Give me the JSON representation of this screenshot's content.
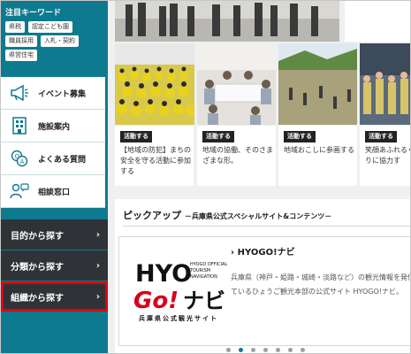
{
  "sidebar": {
    "keyword_title": "注目キーワード",
    "tags": [
      "県税",
      "認定こども園",
      "職員採用",
      "入札・契約",
      "県営住宅"
    ],
    "menu": [
      {
        "label": "イベント募集",
        "icon": "megaphone-icon"
      },
      {
        "label": "施設案内",
        "icon": "building-icon"
      },
      {
        "label": "よくある質問",
        "icon": "faq-icon"
      },
      {
        "label": "相談窓口",
        "icon": "consultation-icon"
      }
    ],
    "nav": [
      {
        "label": "目的から探す",
        "chevron": "›"
      },
      {
        "label": "分類から探す",
        "chevron": "›"
      },
      {
        "label": "組織から探す",
        "chevron": "›"
      }
    ]
  },
  "cards": [
    {
      "badge": "活動する",
      "text": "【地域の防犯】まちの安全を守る活動に参加する"
    },
    {
      "badge": "活動する",
      "text": "地域の協働、そのさまざまな形。"
    },
    {
      "badge": "活動する",
      "text": "地域おこしに参画する"
    },
    {
      "badge": "活動する",
      "text": "笑顔あふれるくりに協力す"
    }
  ],
  "pickup": {
    "title": "ピックアップ",
    "subtitle": "－兵庫県公式スペシャルサイト&コンテンツ－",
    "item_title": "› HYOGO!ナビ",
    "item_desc_line1": "兵庫県（神戸・姫路・城崎・淡路など）の観光情報を発信",
    "item_desc_line2": "ているひょうご観光本部の公式サイト HYOGO!ナビ。",
    "logo_text_top": "HYO",
    "logo_text_go": "Go!",
    "logo_text_navi": "ナビ",
    "logo_small_1": "HYOGO OFFICIAL",
    "logo_small_2": "TOURISM",
    "logo_small_3": "NAVIGATION",
    "logo_caption": "兵庫県公式観光サイト"
  },
  "colors": {
    "teal": "#0e7a8f",
    "dark_nav": "#2f3337",
    "highlight": "#e00010",
    "logo_red": "#d7001a"
  }
}
